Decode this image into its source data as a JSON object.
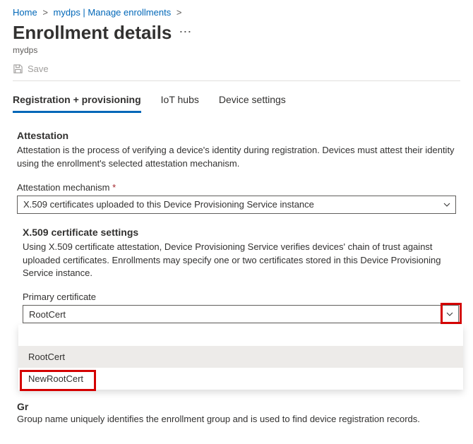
{
  "breadcrumb": {
    "home": "Home",
    "path": "mydps | Manage enrollments"
  },
  "header": {
    "title": "Enrollment details",
    "subtitle": "mydps"
  },
  "toolbar": {
    "save_label": "Save"
  },
  "tabs": {
    "t1": "Registration + provisioning",
    "t2": "IoT hubs",
    "t3": "Device settings"
  },
  "attestation": {
    "title": "Attestation",
    "desc": "Attestation is the process of verifying a device's identity during registration. Devices must attest their identity using the enrollment's selected attestation mechanism.",
    "mech_label": "Attestation mechanism",
    "mech_value": "X.509 certificates uploaded to this Device Provisioning Service instance"
  },
  "certs": {
    "title": "X.509 certificate settings",
    "desc": "Using X.509 certificate attestation, Device Provisioning Service verifies devices' chain of trust against uploaded certificates. Enrollments may specify one or two certificates stored in this Device Provisioning Service instance.",
    "primary_label": "Primary certificate",
    "primary_value": "RootCert",
    "options": {
      "o1": "RootCert",
      "o2": "NewRootCert"
    }
  },
  "group": {
    "title_partial": "Gr",
    "desc": "Group name uniquely identifies the enrollment group and is used to find device registration records."
  }
}
